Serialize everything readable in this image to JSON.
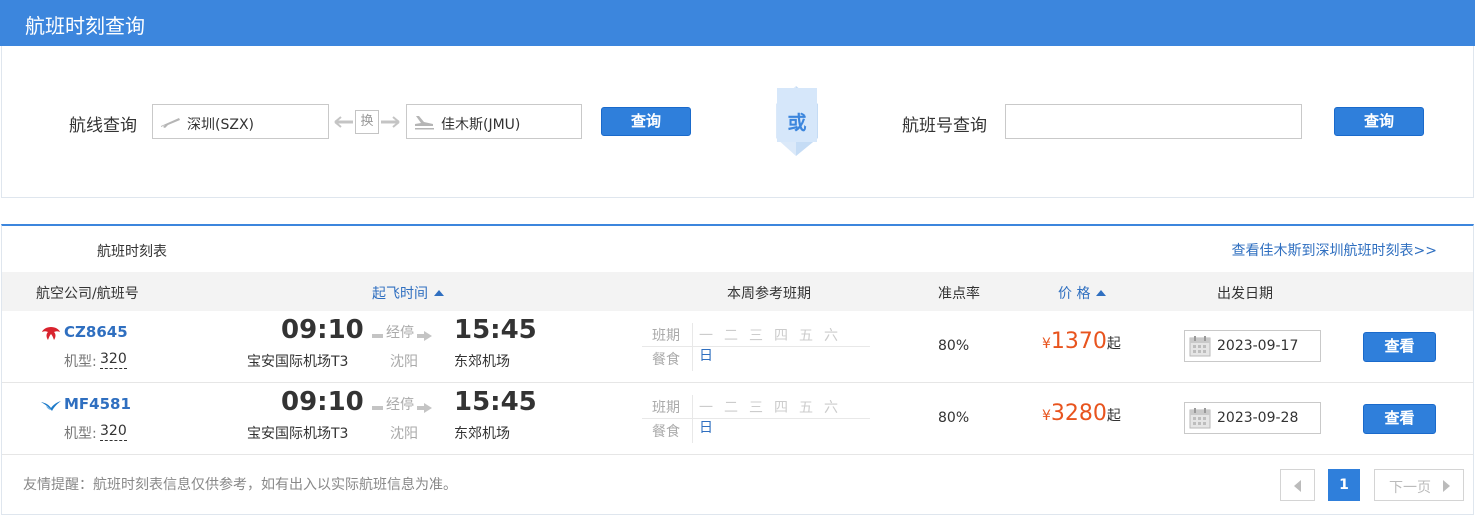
{
  "header": {
    "title": "航班时刻查询"
  },
  "search": {
    "route_label": "航线查询",
    "from_city": "深圳(SZX)",
    "swap_label": "换",
    "to_city": "佳木斯(JMU)",
    "route_query_button": "查询",
    "or_label": "或",
    "flight_no_label": "航班号查询",
    "flight_no_value": "",
    "flight_no_query_button": "查询"
  },
  "schedule": {
    "title": "航班时刻表",
    "reverse_link": "查看佳木斯到深圳航班时刻表>>",
    "columns": {
      "airline": "航空公司/航班号",
      "depart_time": "起飞时间",
      "week": "本周参考班期",
      "ontime": "准点率",
      "price": "价 格",
      "date": "出发日期"
    },
    "week_labels": {
      "schedule": "班期",
      "meal": "餐食"
    },
    "days": [
      "一",
      "二",
      "三",
      "四",
      "五",
      "六",
      "日"
    ],
    "rows": [
      {
        "airline_icon": "china-southern-logo",
        "flight_no": "CZ8645",
        "type_label": "机型:",
        "type_value": "320",
        "dep_time": "09:10",
        "dep_airport": "宝安国际机场T3",
        "via_label": "经停",
        "via_city": "沈阳",
        "arr_time": "15:45",
        "arr_airport": "东郊机场",
        "active_days": [
          7
        ],
        "ontime": "80%",
        "currency": "¥",
        "price": "1370",
        "price_suffix": "起",
        "date": "2023-09-17",
        "view_button": "查看"
      },
      {
        "airline_icon": "xiamen-airlines-logo",
        "flight_no": "MF4581",
        "type_label": "机型:",
        "type_value": "320",
        "dep_time": "09:10",
        "dep_airport": "宝安国际机场T3",
        "via_label": "经停",
        "via_city": "沈阳",
        "arr_time": "15:45",
        "arr_airport": "东郊机场",
        "active_days": [
          7
        ],
        "ontime": "80%",
        "currency": "¥",
        "price": "3280",
        "price_suffix": "起",
        "date": "2023-09-28",
        "view_button": "查看"
      }
    ],
    "notice": "友情提醒：航班时刻表信息仅供参考，如有出入以实际航班信息为准。",
    "pager": {
      "current": "1",
      "next_label": "下一页"
    }
  },
  "colors": {
    "header_bg": "#3c86dd",
    "link": "#2f6fc0",
    "price": "#e8541e",
    "button": "#2f7fdb"
  }
}
